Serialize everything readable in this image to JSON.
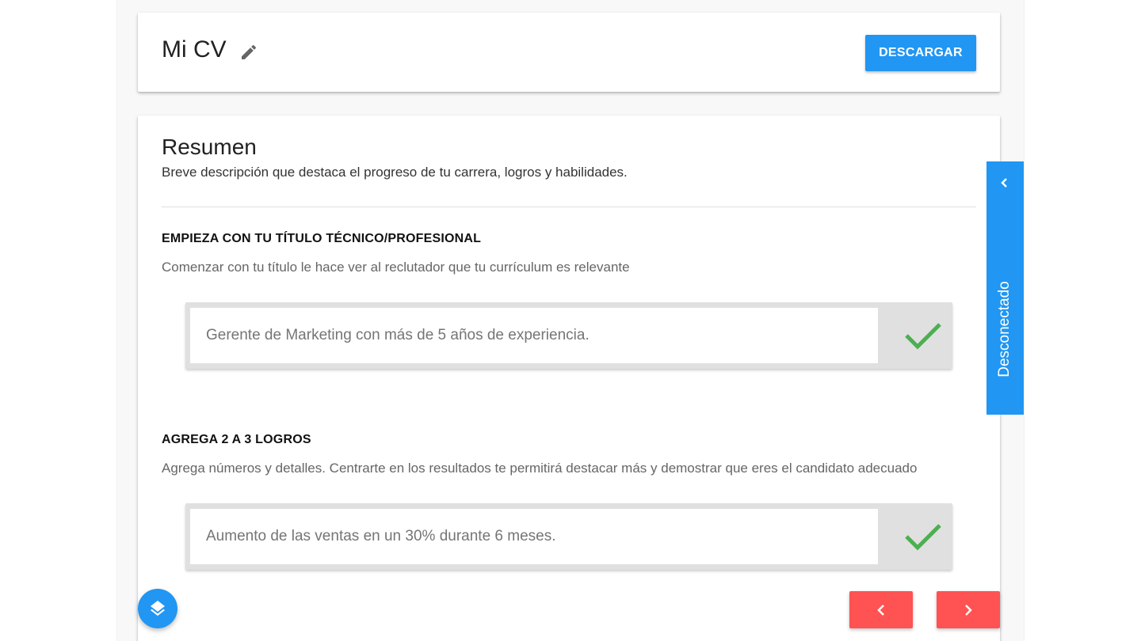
{
  "header": {
    "title": "Mi CV",
    "edit_icon": "pencil-icon",
    "download_label": "DESCARGAR"
  },
  "summary": {
    "title": "Resumen",
    "description": "Breve descripción que destaca el progreso de tu carrera, logros y habilidades.",
    "tips": [
      {
        "heading": "EMPIEZA CON TU TÍTULO TÉCNICO/PROFESIONAL",
        "text": "Comenzar con tu título le hace ver al reclutador que tu currículum es relevante",
        "example": "Gerente de Marketing con más de 5 años de experiencia.",
        "status_icon": "check-icon"
      },
      {
        "heading": "AGREGA 2 A 3 LOGROS",
        "text": "Agrega números y detalles. Centrarte en los resultados te permitirá destacar más y demostrar que eres el candidato adecuado",
        "example": "Aumento de las ventas en un 30% durante 6 meses.",
        "status_icon": "check-icon"
      }
    ]
  },
  "side_panel": {
    "label": "Desconectado",
    "icon": "chevron-left-icon"
  },
  "fab": {
    "icon": "layers-icon"
  },
  "navigation": {
    "prev_icon": "chevron-left-icon",
    "next_icon": "chevron-right-icon"
  },
  "colors": {
    "primary": "#2196f3",
    "accent": "#ff5252",
    "success": "#4caf50",
    "example_bg": "#e0e0e0"
  }
}
